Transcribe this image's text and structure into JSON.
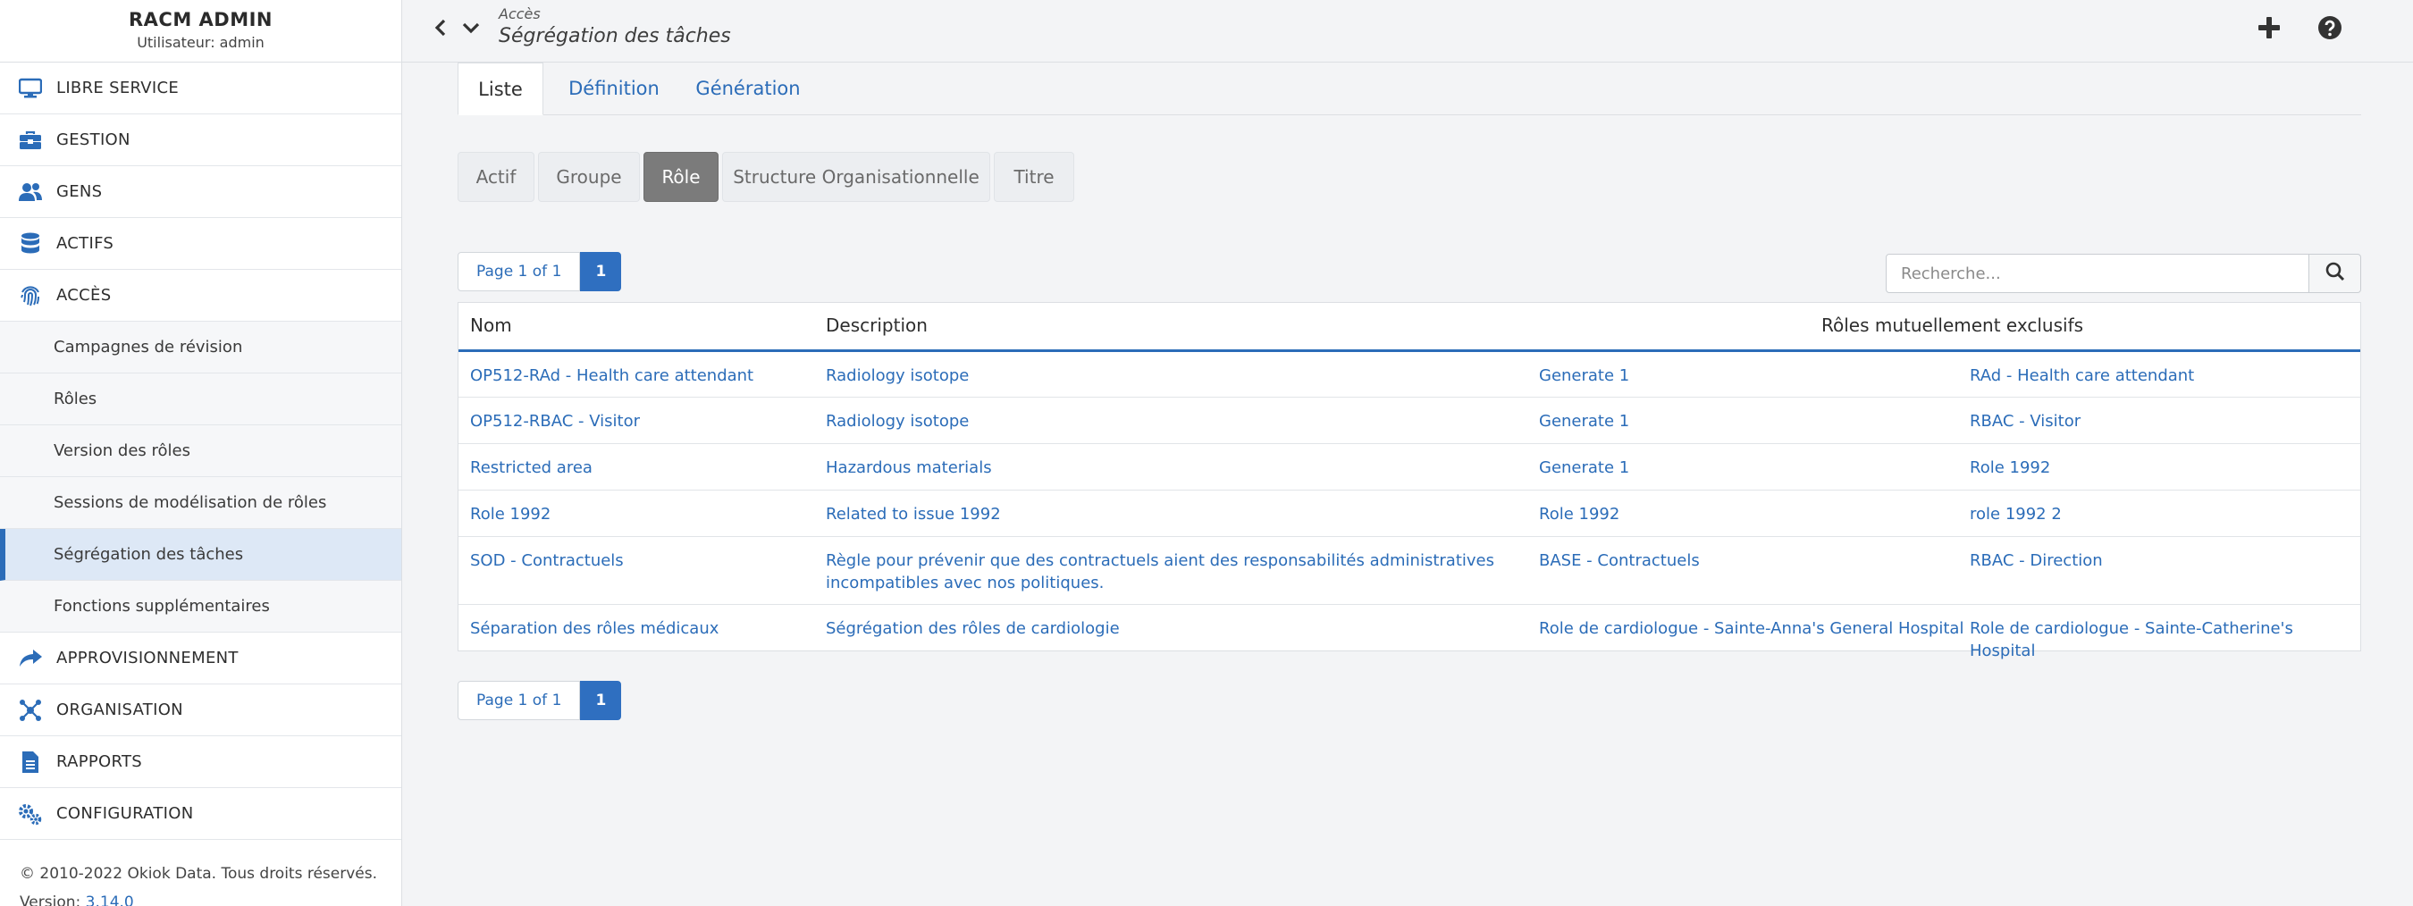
{
  "sidebar": {
    "app_title": "RACM ADMIN",
    "user_line": "Utilisateur: admin",
    "items": [
      {
        "label": "LIBRE SERVICE",
        "icon": "monitor-icon"
      },
      {
        "label": "GESTION",
        "icon": "toolbox-icon"
      },
      {
        "label": "GENS",
        "icon": "users-icon"
      },
      {
        "label": "ACTIFS",
        "icon": "database-icon"
      },
      {
        "label": "ACCÈS",
        "icon": "fingerprint-icon"
      }
    ],
    "sub_items": [
      {
        "label": "Campagnes de révision"
      },
      {
        "label": "Rôles"
      },
      {
        "label": "Version des rôles"
      },
      {
        "label": "Sessions de modélisation de rôles"
      },
      {
        "label": "Ségrégation des tâches"
      },
      {
        "label": "Fonctions supplémentaires"
      }
    ],
    "items_after": [
      {
        "label": "APPROVISIONNEMENT",
        "icon": "share-arrow-icon"
      },
      {
        "label": "ORGANISATION",
        "icon": "network-icon"
      },
      {
        "label": "RAPPORTS",
        "icon": "report-icon"
      },
      {
        "label": "CONFIGURATION",
        "icon": "gears-icon"
      }
    ],
    "copyright": "© 2010-2022 Okiok Data. Tous droits réservés.",
    "version_label": "Version:",
    "version_value": "3.14.0"
  },
  "header": {
    "breadcrumb_parent": "Accès",
    "page_title": "Ségrégation des tâches"
  },
  "tabs": [
    {
      "label": "Liste",
      "active": true
    },
    {
      "label": "Définition",
      "active": false
    },
    {
      "label": "Génération",
      "active": false
    }
  ],
  "filters": [
    {
      "label": "Actif",
      "active": false
    },
    {
      "label": "Groupe",
      "active": false
    },
    {
      "label": "Rôle",
      "active": true
    },
    {
      "label": "Structure Organisationnelle",
      "active": false
    },
    {
      "label": "Titre",
      "active": false
    }
  ],
  "pagination": {
    "info": "Page 1 of 1",
    "current": "1"
  },
  "search": {
    "placeholder": "Recherche..."
  },
  "table": {
    "headers": {
      "name": "Nom",
      "description": "Description",
      "exclusive": "Rôles mutuellement exclusifs"
    },
    "rows": [
      {
        "name": "OP512-RAd - Health care attendant",
        "description": "Radiology isotope",
        "role_a": "Generate 1",
        "role_b": "RAd - Health care attendant"
      },
      {
        "name": "OP512-RBAC - Visitor",
        "description": "Radiology isotope",
        "role_a": "Generate 1",
        "role_b": "RBAC - Visitor"
      },
      {
        "name": "Restricted area",
        "description": "Hazardous materials",
        "role_a": "Generate 1",
        "role_b": "Role 1992"
      },
      {
        "name": "Role 1992",
        "description": "Related to issue 1992",
        "role_a": "Role 1992",
        "role_b": "role 1992 2"
      },
      {
        "name": "SOD - Contractuels",
        "description": "Règle pour prévenir que des contractuels aient des responsabilités administratives incompatibles avec nos politiques.",
        "role_a": "BASE - Contractuels",
        "role_b": "RBAC - Direction"
      },
      {
        "name": "Séparation des rôles médicaux",
        "description": "Ségrégation des rôles de cardiologie",
        "role_a": "Role de cardiologue - Sainte-Anna's General Hospital",
        "role_b": "Role de cardiologue - Sainte-Catherine's Hospital"
      }
    ]
  },
  "colors": {
    "accent": "#2b6cb8",
    "active_pill": "#7b7b7b",
    "active_nav": "#dde8f6"
  }
}
